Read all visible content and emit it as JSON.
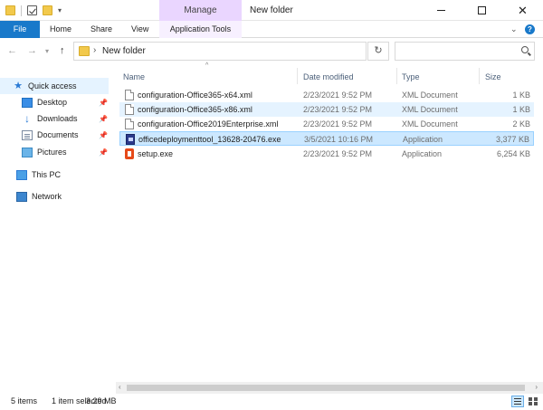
{
  "window": {
    "title": "New folder",
    "context_tab_group": "Manage",
    "controls": [
      "minimize",
      "maximize",
      "close"
    ]
  },
  "ribbon": {
    "file_tab": "File",
    "tabs": [
      "Home",
      "Share",
      "View"
    ],
    "contextual_tab": "Application Tools",
    "accent_color": "#1979ca",
    "manage_color": "#ead6ff"
  },
  "address": {
    "path": "New folder",
    "search_placeholder": ""
  },
  "nav_pane": {
    "quick_access": "Quick access",
    "items": [
      {
        "label": "Desktop",
        "icon": "desktop-icon",
        "pinned": true
      },
      {
        "label": "Downloads",
        "icon": "downloads-icon",
        "pinned": true
      },
      {
        "label": "Documents",
        "icon": "documents-icon",
        "pinned": true
      },
      {
        "label": "Pictures",
        "icon": "pictures-icon",
        "pinned": true
      }
    ],
    "this_pc": "This PC",
    "network": "Network"
  },
  "columns": {
    "name": "Name",
    "date": "Date modified",
    "type": "Type",
    "size": "Size"
  },
  "files": [
    {
      "name": "configuration-Office365-x64.xml",
      "date": "2/23/2021 9:52 PM",
      "type": "XML Document",
      "size": "1 KB",
      "icon": "xml-file-icon"
    },
    {
      "name": "configuration-Office365-x86.xml",
      "date": "2/23/2021 9:52 PM",
      "type": "XML Document",
      "size": "1 KB",
      "icon": "xml-file-icon"
    },
    {
      "name": "configuration-Office2019Enterprise.xml",
      "date": "2/23/2021 9:52 PM",
      "type": "XML Document",
      "size": "2 KB",
      "icon": "xml-file-icon"
    },
    {
      "name": "officedeploymenttool_13628-20476.exe",
      "date": "3/5/2021 10:16 PM",
      "type": "Application",
      "size": "3,377 KB",
      "icon": "deployment-tool-icon"
    },
    {
      "name": "setup.exe",
      "date": "2/23/2021 9:52 PM",
      "type": "Application",
      "size": "6,254 KB",
      "icon": "office-setup-icon"
    }
  ],
  "status": {
    "items": "5 items",
    "selected": "1 item selected",
    "size": "3.29 MB"
  }
}
